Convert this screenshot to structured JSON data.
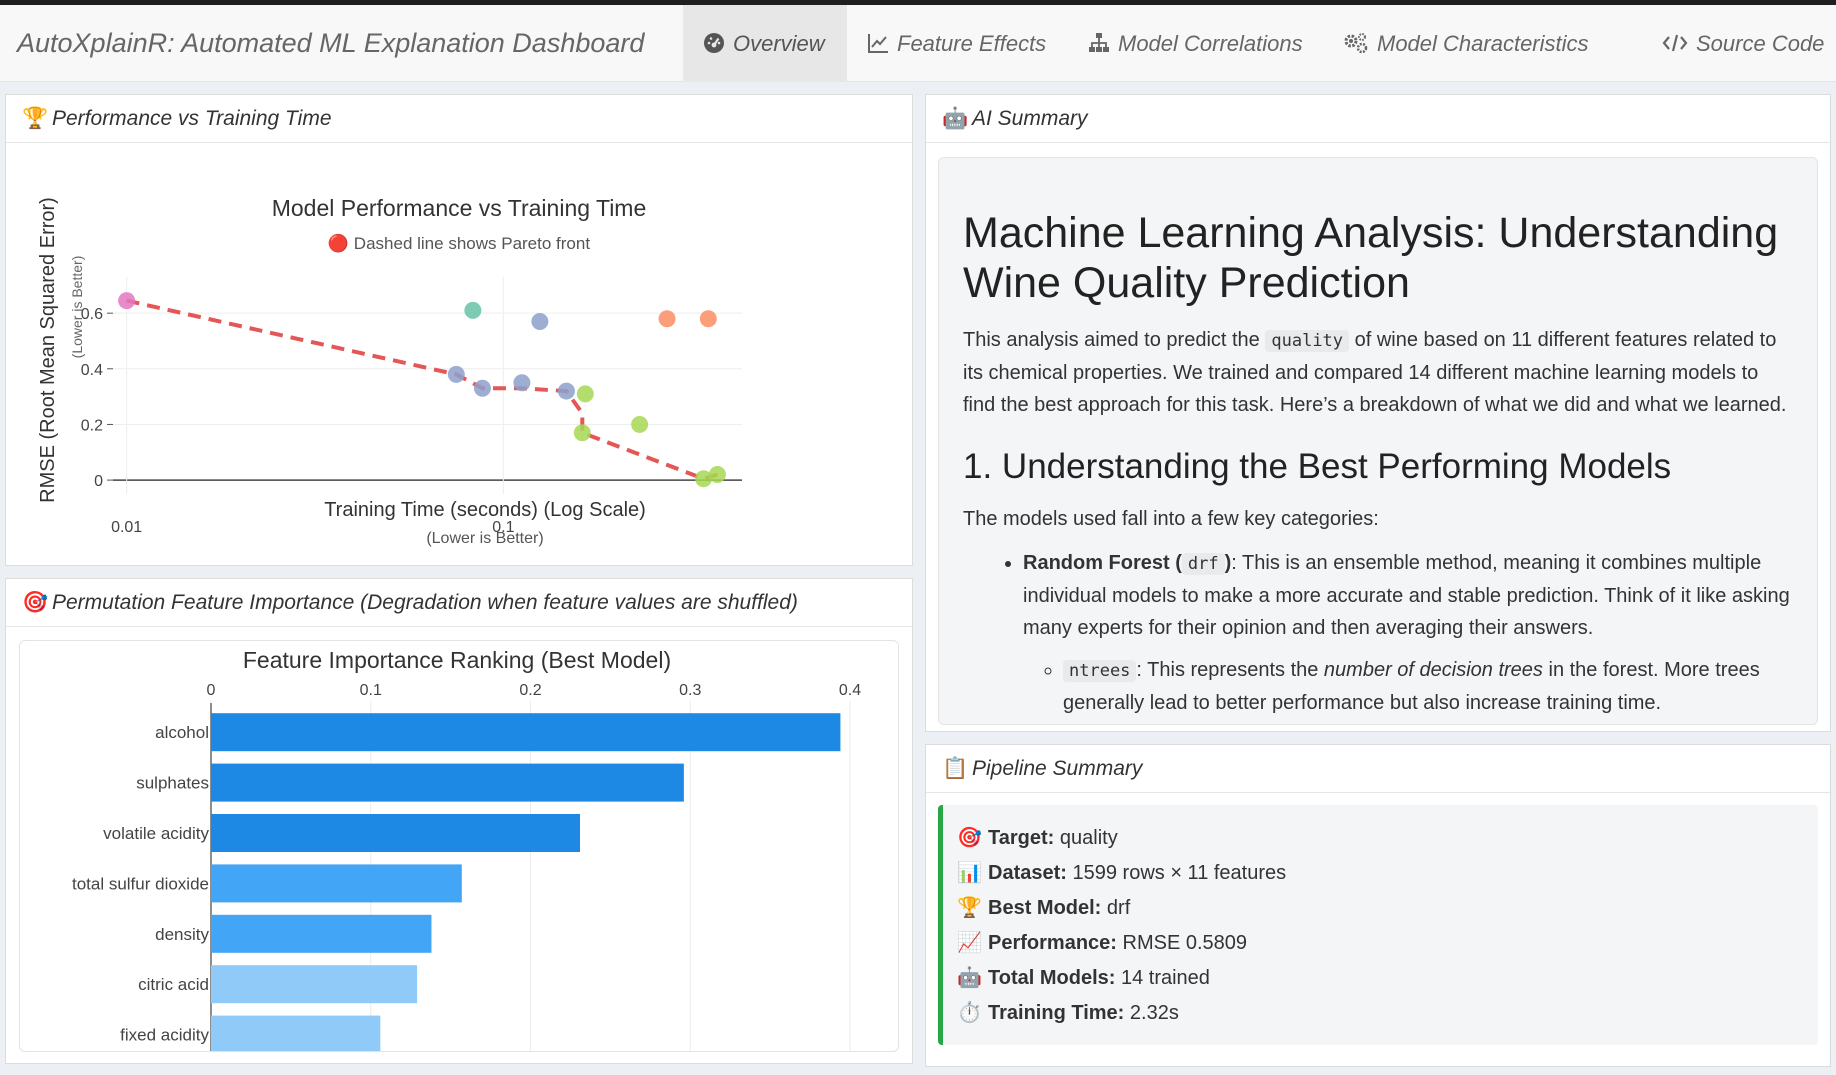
{
  "app": {
    "title": "AutoXplainR: Automated ML Explanation Dashboard"
  },
  "nav": {
    "tabs": [
      {
        "label": "Overview",
        "icon": "dashboard-icon",
        "active": true
      },
      {
        "label": "Feature Effects",
        "icon": "line-chart-icon"
      },
      {
        "label": "Model Correlations",
        "icon": "sitemap-icon"
      },
      {
        "label": "Model Characteristics",
        "icon": "cogs-icon"
      },
      {
        "label": "Source Code",
        "icon": "code-icon"
      }
    ]
  },
  "performance_panel": {
    "header": "Performance vs Training Time",
    "icon": "trophy-icon"
  },
  "permutation_panel": {
    "header": "Permutation Feature Importance (Degradation when feature values are shuffled)",
    "icon": "target-icon"
  },
  "ai_panel": {
    "header": "AI Summary",
    "icon": "robot-icon",
    "heading": "Machine Learning Analysis: Understanding Wine Quality Prediction",
    "intro_before": "This analysis aimed to predict the ",
    "intro_code": "quality",
    "intro_after": " of wine based on 11 different features related to its chemical properties. We trained and compared 14 different machine learning models to find the best approach for this task. Here’s a breakdown of what we did and what we learned.",
    "section1": "1. Understanding the Best Performing Models",
    "section1_text": "The models used fall into a few key categories:",
    "bullet1_bold": "Random Forest (",
    "bullet1_code": "drf",
    "bullet1_bold_end": ")",
    "bullet1_text": ": This is an ensemble method, meaning it combines multiple individual models to make a more accurate and stable prediction. Think of it like asking many experts for their opinion and then averaging their answers.",
    "sub_code": "ntrees",
    "sub_text_before": ": This represents the ",
    "sub_italic": "number of decision trees",
    "sub_text_after": " in the forest. More trees generally lead to better performance but also increase training time."
  },
  "pipeline_panel": {
    "header": "Pipeline Summary",
    "icon": "clipboard-icon",
    "rows": [
      {
        "icon": "target-icon",
        "label": "Target:",
        "value": "quality"
      },
      {
        "icon": "bar-chart-icon",
        "label": "Dataset:",
        "value": "1599 rows × 11 features"
      },
      {
        "icon": "trophy-icon",
        "label": "Best Model:",
        "value": "drf"
      },
      {
        "icon": "trend-icon",
        "label": "Performance:",
        "value": "RMSE 0.5809"
      },
      {
        "icon": "robot-icon",
        "label": "Total Models:",
        "value": "14 trained"
      },
      {
        "icon": "stopwatch-icon",
        "label": "Training Time:",
        "value": "2.32s"
      }
    ]
  },
  "chart_data": [
    {
      "type": "scatter",
      "title": "Model Performance vs Training Time",
      "subtitle": "🔴 Dashed line shows Pareto front",
      "xlabel": "Training Time (seconds) (Log Scale)",
      "xlabel_sub": "(Lower is Better)",
      "ylabel": "RMSE (Root Mean Squared Error)",
      "ylabel_sub": "(Lower is Better)",
      "x_scale": "log",
      "x_ticks": [
        {
          "value": 0.01,
          "label": "0.01"
        },
        {
          "value": 0.1,
          "label": "0.1"
        }
      ],
      "y_ticks": [
        {
          "value": 0,
          "label": "0"
        },
        {
          "value": 0.2,
          "label": "0.2"
        },
        {
          "value": 0.4,
          "label": "0.4"
        },
        {
          "value": 0.6,
          "label": "0.6"
        }
      ],
      "xlim": [
        0.0092,
        0.43
      ],
      "ylim": [
        -0.05,
        0.73
      ],
      "grid": true,
      "points": [
        {
          "x": 0.01,
          "y": 0.645,
          "color": "#e377c2"
        },
        {
          "x": 0.083,
          "y": 0.61,
          "color": "#66c2a5"
        },
        {
          "x": 0.125,
          "y": 0.57,
          "color": "#8da0cb"
        },
        {
          "x": 0.272,
          "y": 0.58,
          "color": "#fc8d62"
        },
        {
          "x": 0.35,
          "y": 0.58,
          "color": "#fc8d62"
        },
        {
          "x": 0.075,
          "y": 0.38,
          "color": "#8da0cb"
        },
        {
          "x": 0.088,
          "y": 0.33,
          "color": "#8da0cb"
        },
        {
          "x": 0.112,
          "y": 0.35,
          "color": "#8da0cb"
        },
        {
          "x": 0.147,
          "y": 0.32,
          "color": "#8da0cb"
        },
        {
          "x": 0.165,
          "y": 0.31,
          "color": "#a6d854"
        },
        {
          "x": 0.162,
          "y": 0.17,
          "color": "#a6d854"
        },
        {
          "x": 0.23,
          "y": 0.2,
          "color": "#a6d854"
        },
        {
          "x": 0.34,
          "y": 0.005,
          "color": "#a6d854"
        },
        {
          "x": 0.37,
          "y": 0.02,
          "color": "#a6d854"
        }
      ],
      "pareto_front": [
        {
          "x": 0.01,
          "y": 0.645
        },
        {
          "x": 0.075,
          "y": 0.38
        },
        {
          "x": 0.088,
          "y": 0.33
        },
        {
          "x": 0.112,
          "y": 0.33
        },
        {
          "x": 0.147,
          "y": 0.32
        },
        {
          "x": 0.162,
          "y": 0.24
        },
        {
          "x": 0.162,
          "y": 0.17
        },
        {
          "x": 0.34,
          "y": 0.005
        },
        {
          "x": 0.37,
          "y": 0.02
        }
      ],
      "pareto_color": "#e45756"
    },
    {
      "type": "bar",
      "orientation": "horizontal",
      "title": "Feature Importance Ranking (Best Model)",
      "categories": [
        "alcohol",
        "sulphates",
        "volatile acidity",
        "total sulfur dioxide",
        "density",
        "citric acid",
        "fixed acidity"
      ],
      "values": [
        0.394,
        0.296,
        0.231,
        0.157,
        0.138,
        0.129,
        0.106
      ],
      "colors": [
        "#1e88e5",
        "#1e88e5",
        "#1e88e5",
        "#42a5f5",
        "#42a5f5",
        "#90caf9",
        "#90caf9"
      ],
      "x_ticks": [
        {
          "value": 0,
          "label": "0"
        },
        {
          "value": 0.1,
          "label": "0.1"
        },
        {
          "value": 0.2,
          "label": "0.2"
        },
        {
          "value": 0.3,
          "label": "0.3"
        },
        {
          "value": 0.4,
          "label": "0.4"
        }
      ],
      "xlim": [
        0,
        0.4
      ],
      "x_axis_position": "top",
      "grid": true
    }
  ]
}
